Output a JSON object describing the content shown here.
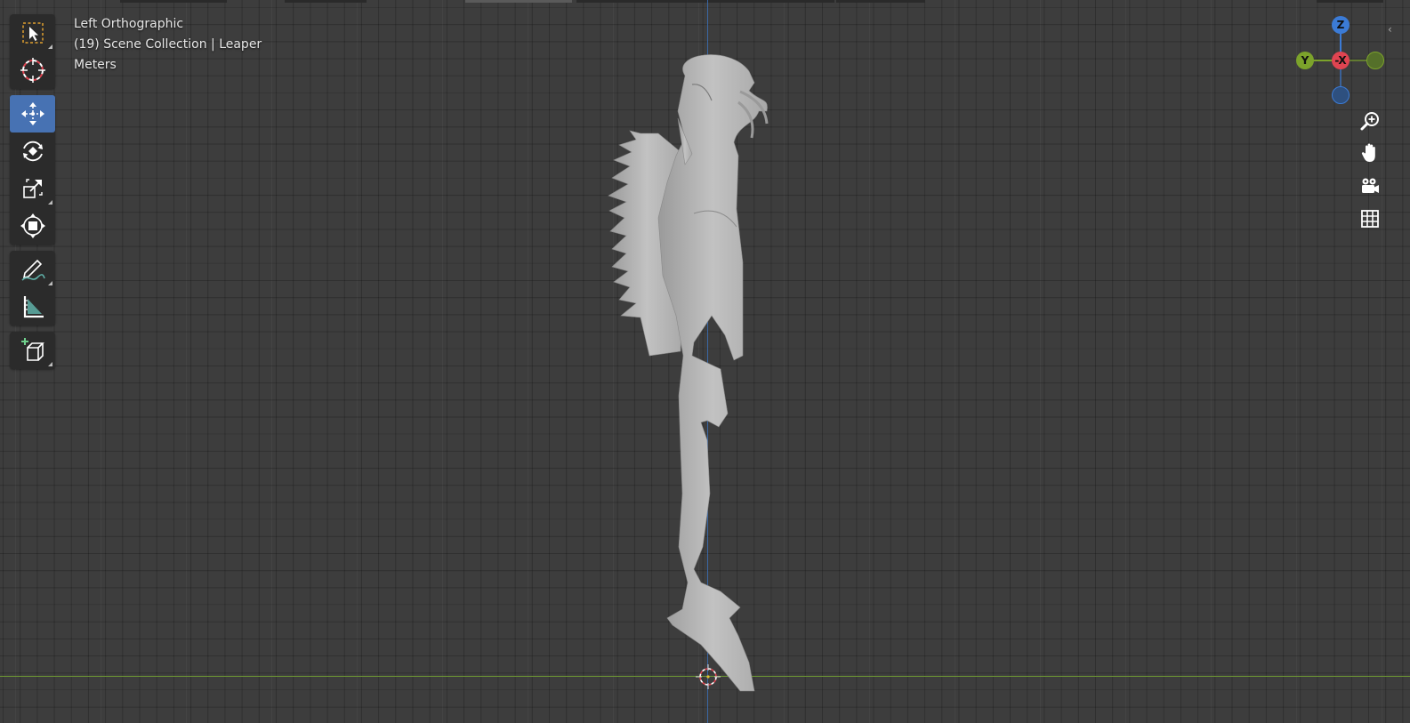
{
  "viewport": {
    "view_name": "Left Orthographic",
    "collection_info": "(19) Scene Collection | Leaper",
    "units": "Meters",
    "colors": {
      "background": "#3d3d3d",
      "active_tool": "#4772b3",
      "axis_x": "#e04451",
      "axis_y": "#7ca32b",
      "axis_z": "#3b7bd6",
      "model": "#b9b9b9"
    }
  },
  "toolbar": {
    "tools": [
      {
        "name": "select-box",
        "icon": "select-box-icon"
      },
      {
        "name": "cursor",
        "icon": "cursor-icon"
      },
      {
        "name": "move",
        "icon": "move-icon",
        "active": true
      },
      {
        "name": "rotate",
        "icon": "rotate-icon"
      },
      {
        "name": "scale",
        "icon": "scale-icon"
      },
      {
        "name": "transform",
        "icon": "transform-icon"
      },
      {
        "name": "annotate",
        "icon": "annotate-icon"
      },
      {
        "name": "measure",
        "icon": "measure-icon"
      },
      {
        "name": "add-cube",
        "icon": "add-cube-icon"
      }
    ]
  },
  "gizmo": {
    "z_label": "Z",
    "y_label": "Y",
    "x_label": "-X"
  },
  "nav": {
    "buttons": [
      "zoom-icon",
      "pan-hand-icon",
      "camera-icon",
      "grid-icon"
    ]
  }
}
